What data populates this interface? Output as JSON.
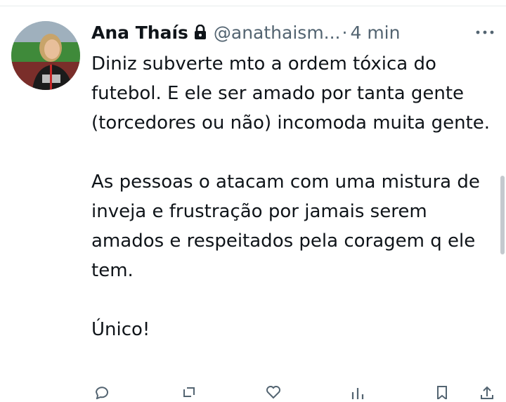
{
  "tweet": {
    "author_name": "Ana Thaís",
    "handle": "@anathaism...",
    "separator": "·",
    "time": "4 min",
    "paragraphs": [
      "Diniz subverte mto a ordem tóxica do futebol. E ele ser amado por tanta gente (torcedores ou não) incomoda muita gente.",
      "As pessoas o atacam com uma mistura de inveja e frustração por jamais serem amados e respeitados pela coragem q ele tem.",
      "Único!"
    ]
  },
  "icons": {
    "lock": "lock-icon",
    "more": "more-icon",
    "actions": [
      "reply-icon",
      "retweet-icon",
      "like-icon",
      "views-icon",
      "bookmark-icon",
      "share-icon"
    ]
  },
  "colors": {
    "text": "#0f1419",
    "secondary": "#536471",
    "divider": "#e8ebed"
  }
}
